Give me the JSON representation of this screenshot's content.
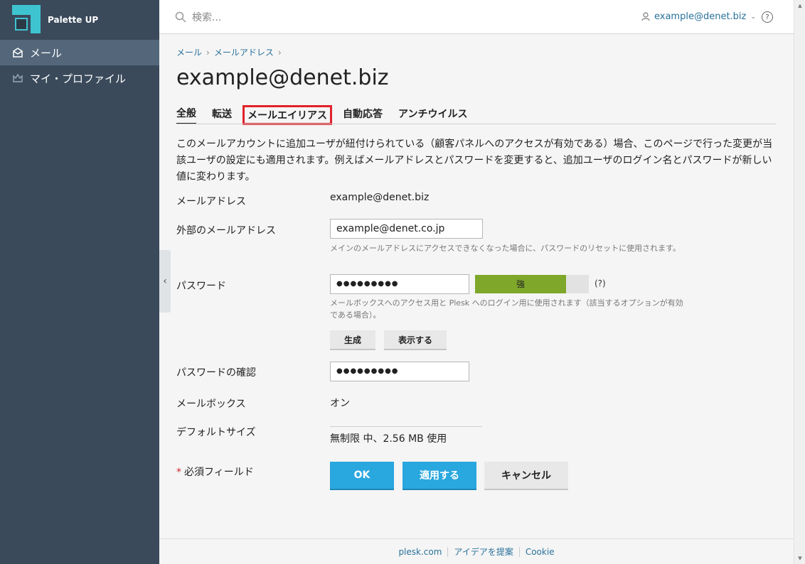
{
  "app": {
    "name": "Palette UP"
  },
  "sidebar": {
    "items": [
      {
        "label": "メール",
        "icon": "mail-icon",
        "active": true
      },
      {
        "label": "マイ・プロファイル",
        "icon": "crown-icon",
        "active": false
      }
    ]
  },
  "header": {
    "search_placeholder": "検索...",
    "user_email": "example@denet.biz",
    "help": "?"
  },
  "breadcrumb": [
    "メール",
    "メールアドレス"
  ],
  "page": {
    "title": "example@denet.biz"
  },
  "tabs": [
    {
      "label": "全般",
      "active": true
    },
    {
      "label": "転送"
    },
    {
      "label": "メールエイリアス",
      "highlighted": true
    },
    {
      "label": "自動応答"
    },
    {
      "label": "アンチウイルス"
    }
  ],
  "description": "このメールアカウントに追加ユーザが紐付けられている（顧客パネルへのアクセスが有効である）場合、このページで行った変更が当該ユーザの設定にも適用されます。例えばメールアドレスとパスワードを変更すると、追加ユーザのログイン名とパスワードが新しい値に変わります。",
  "form": {
    "email_label": "メールアドレス",
    "email_value": "example@denet.biz",
    "external_label": "外部のメールアドレス",
    "external_value": "example@denet.co.jp",
    "external_hint": "メインのメールアドレスにアクセスできなくなった場合に、パスワードのリセットに使用されます。",
    "password_label": "パスワード",
    "password_value": "●●●●●●●●●",
    "password_strength": "強",
    "password_strength_level": 0.8,
    "password_help": "(?)",
    "password_hint": "メールボックスへのアクセス用と Plesk へのログイン用に使用されます（該当するオプションが有効である場合）。",
    "generate_label": "生成",
    "show_label": "表示する",
    "confirm_label": "パスワードの確認",
    "confirm_value": "●●●●●●●●●",
    "mailbox_label": "メールボックス",
    "mailbox_value": "オン",
    "size_label": "デフォルトサイズ",
    "size_value": "無制限 中、2.56 MB 使用",
    "required_label": "必須フィールド",
    "required_star": "*"
  },
  "buttons": {
    "ok": "OK",
    "apply": "適用する",
    "cancel": "キャンセル"
  },
  "footer": {
    "links": [
      "plesk.com",
      "アイデアを提案",
      "Cookie"
    ]
  },
  "colors": {
    "accent": "#29a7df",
    "sidebar": "#3a4a5b",
    "strength": "#7fa82b",
    "highlight": "#e0222a"
  }
}
